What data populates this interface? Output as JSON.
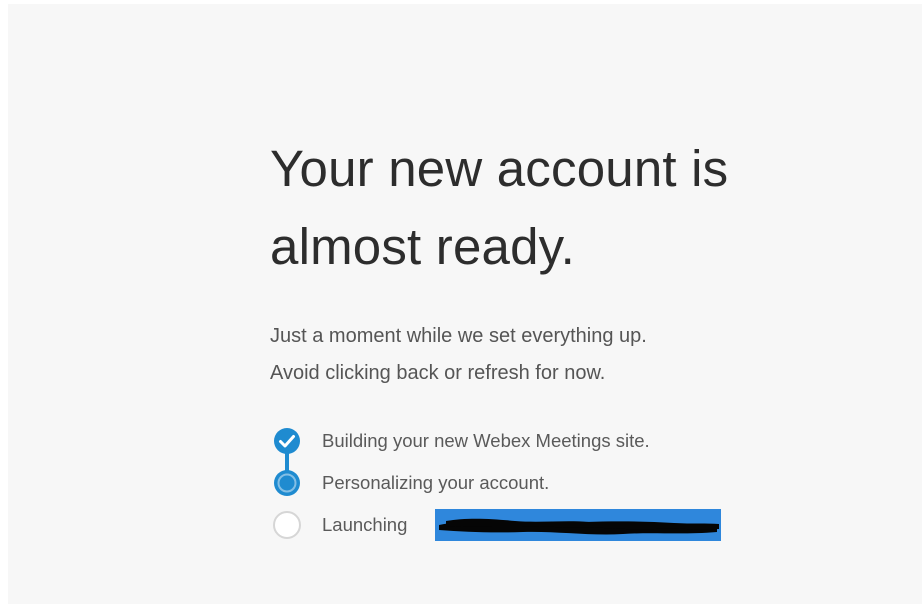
{
  "heading": {
    "line1": "Your new account is",
    "line2": "almost ready."
  },
  "message": {
    "line1": "Just a moment while we set everything up.",
    "line2": "Avoid clicking back or refresh for now."
  },
  "steps": [
    {
      "label": "Building your new Webex Meetings site.",
      "status": "complete",
      "icon": "check-circle-icon"
    },
    {
      "label": "Personalizing your account.",
      "status": "in-progress",
      "icon": "progress-circle-icon"
    },
    {
      "label": "Launching",
      "status": "pending",
      "icon": "empty-circle-icon"
    }
  ],
  "colors": {
    "accent": "#1f8bd0",
    "panel_background": "#f7f7f7",
    "heading_text": "#2d2d2d",
    "body_text": "#555555",
    "pending_ring": "#d6d6d6",
    "redaction_highlight": "#2f87dc",
    "redaction_mark": "#050505"
  }
}
